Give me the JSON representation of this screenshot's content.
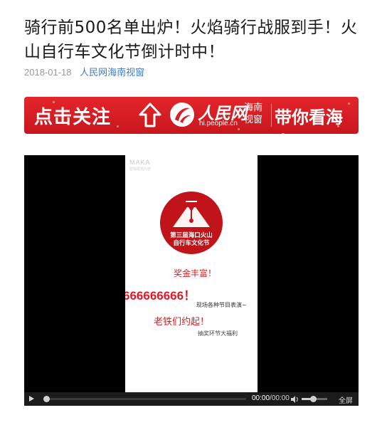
{
  "article": {
    "title": "骑行前500名单出炉！火焰骑行战服到手！火山自行车文化节倒计时中！",
    "date": "2018-01-18",
    "source": "人民网海南视窗"
  },
  "banner": {
    "follow_text": "点击关注",
    "brand_text": "人民网",
    "domain_text": "hi.people.cn",
    "region_text": "海南视窗",
    "slogan_text": "带你看海南",
    "background_color": "#d91f26"
  },
  "video": {
    "poster": {
      "watermark": "MAKA",
      "watermark_sub": "营销视觉内容",
      "emblem_line1": "第三届海口火山",
      "emblem_line2": "自行车文化节",
      "line1": "奖金丰富！",
      "line2": "666666666！",
      "line3": "现场各种节目表演~",
      "line4": "老铁们约起！",
      "line5": "抽奖环节大福利"
    },
    "controls": {
      "current_time": "00:00",
      "separator": "/",
      "total_time": "00:00",
      "fullscreen_label": "全屏",
      "progress": 0,
      "volume": 0.45
    }
  }
}
